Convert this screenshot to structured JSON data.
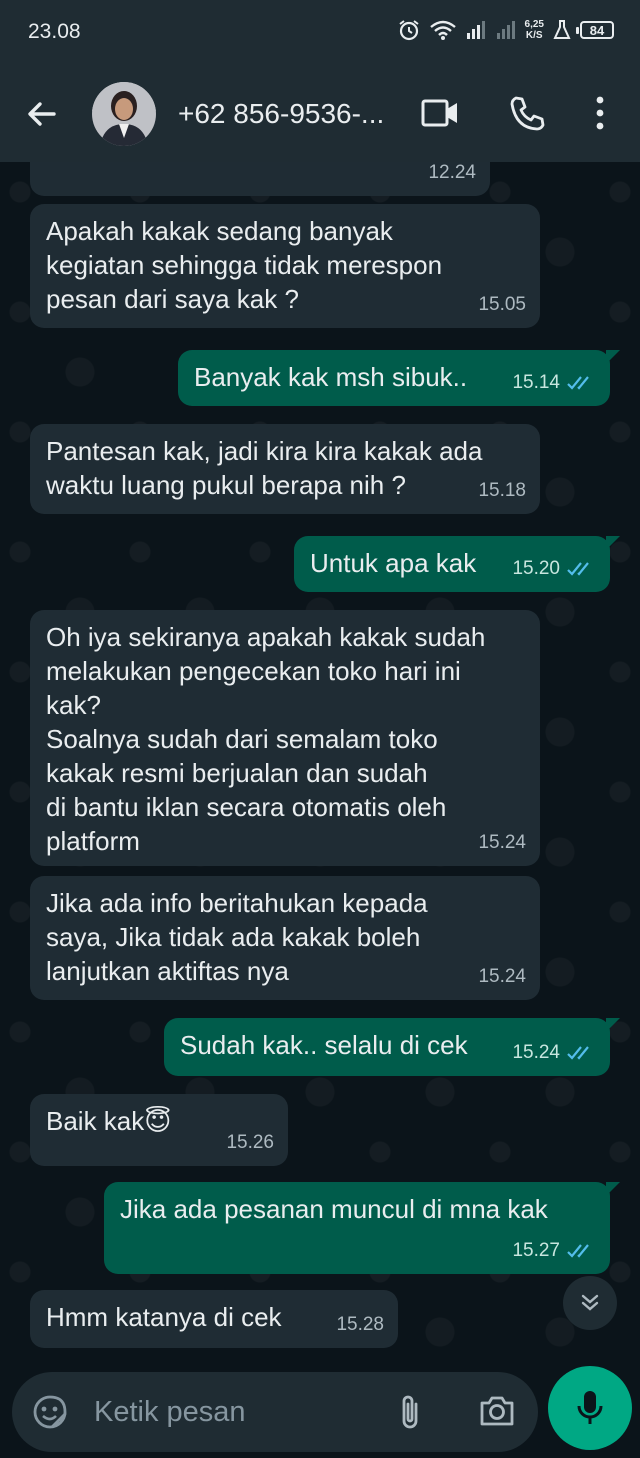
{
  "status_bar": {
    "time": "23.08",
    "net_speed_value": "6,25",
    "net_speed_unit": "K/S",
    "battery": "84"
  },
  "app_bar": {
    "contact": "+62 856-9536-..."
  },
  "messages": [
    {
      "direction": "in",
      "text": "",
      "time": "12.24"
    },
    {
      "direction": "in",
      "text": "Apakah kakak sedang banyak\nkegiatan sehingga tidak merespon\npesan dari saya kak ?",
      "time": "15.05"
    },
    {
      "direction": "out",
      "text": "Banyak kak msh sibuk..",
      "time": "15.14",
      "status": "read"
    },
    {
      "direction": "in",
      "text": "Pantesan kak, jadi kira kira kakak ada\nwaktu luang pukul berapa nih ?",
      "time": "15.18"
    },
    {
      "direction": "out",
      "text": "Untuk apa kak",
      "time": "15.20",
      "status": "read"
    },
    {
      "direction": "in",
      "text": "Oh iya sekiranya apakah kakak sudah\nmelakukan pengecekan toko hari ini\nkak?\nSoalnya sudah dari semalam toko\nkakak resmi berjualan dan sudah\ndi bantu iklan secara otomatis oleh\nplatform",
      "time": "15.24"
    },
    {
      "direction": "in",
      "text": "Jika ada info beritahukan kepada\nsaya, Jika tidak ada kakak boleh\nlanjutkan aktiftas nya",
      "time": "15.24"
    },
    {
      "direction": "out",
      "text": "Sudah kak.. selalu di cek",
      "time": "15.24",
      "status": "read"
    },
    {
      "direction": "in",
      "text": "Baik kak😇",
      "time": "15.26"
    },
    {
      "direction": "out",
      "text": "Jika ada pesanan muncul di mna kak",
      "time": "15.27",
      "status": "read"
    },
    {
      "direction": "in",
      "text": "Hmm katanya di cek",
      "time": "15.28"
    }
  ],
  "input": {
    "placeholder": "Ketik pesan"
  },
  "colors": {
    "incoming_bubble": "#1f2c34",
    "outgoing_bubble": "#005c4b",
    "accent": "#00a884",
    "read_tick": "#53bdeb"
  }
}
